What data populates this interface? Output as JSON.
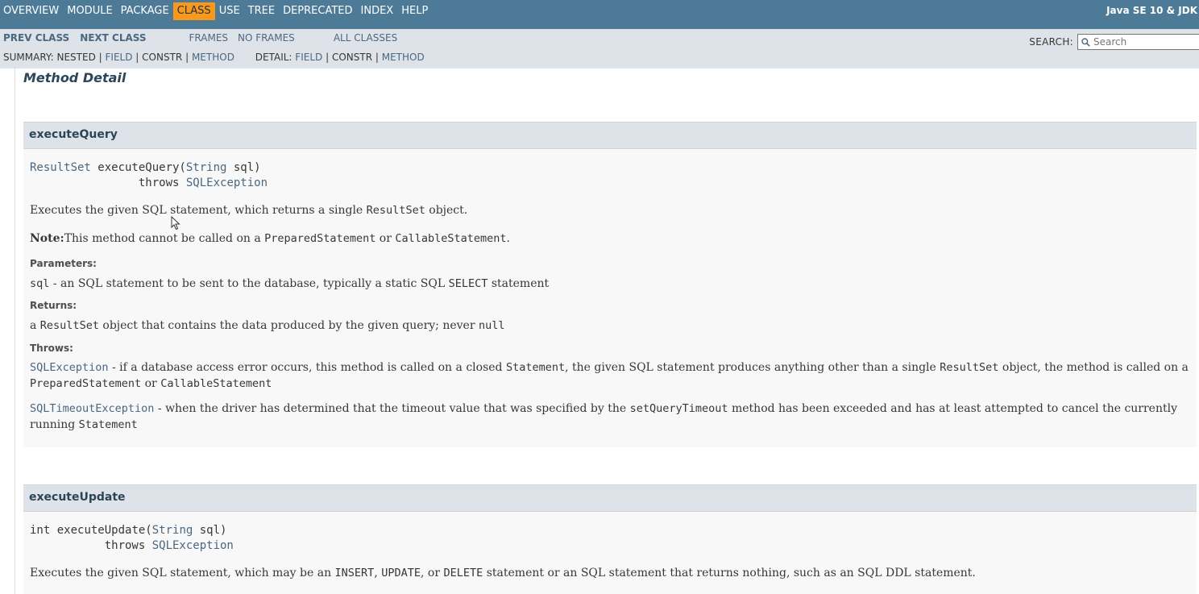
{
  "topnav": {
    "items": [
      {
        "label": "Overview",
        "active": false
      },
      {
        "label": "Module",
        "active": false
      },
      {
        "label": "Package",
        "active": false
      },
      {
        "label": "Class",
        "active": true
      },
      {
        "label": "Use",
        "active": false
      },
      {
        "label": "Tree",
        "active": false
      },
      {
        "label": "Deprecated",
        "active": false
      },
      {
        "label": "Index",
        "active": false
      },
      {
        "label": "Help",
        "active": false
      }
    ],
    "about": "Java SE 10 & JDK"
  },
  "subnav": {
    "prev_class": "PREV CLASS",
    "next_class": "NEXT CLASS",
    "frames": "FRAMES",
    "no_frames": "NO FRAMES",
    "all_classes": "ALL CLASSES",
    "summary_label": "SUMMARY: NESTED |",
    "summary_field": "FIELD",
    "summary_sep1": "|",
    "summary_constr": "CONSTR",
    "summary_sep2": "|",
    "summary_method": "METHOD",
    "detail_label": "DETAIL:",
    "detail_field": "FIELD",
    "detail_sep1": "|",
    "detail_constr": "CONSTR",
    "detail_sep2": "|",
    "detail_method": "METHOD",
    "search_label": "SEARCH:",
    "search_placeholder": "Search"
  },
  "content": {
    "section_title": "Method Detail",
    "method1": {
      "name": "executeQuery",
      "sig_return": "ResultSet",
      "sig_name": " executeQuery(",
      "sig_ptype": "String",
      "sig_pname": " sql)",
      "sig_throws_kw": "                throws ",
      "sig_throws": "SQLException",
      "desc_1": "Executes the given SQL statement, which returns a single ",
      "desc_code": "ResultSet",
      "desc_2": " object.",
      "note_label": "Note:",
      "note_1": "This method cannot be called on a ",
      "note_code1": "PreparedStatement",
      "note_2": " or ",
      "note_code2": "CallableStatement",
      "note_3": ".",
      "params_label": "Parameters:",
      "param_name": "sql",
      "param_desc_1": " - an SQL statement to be sent to the database, typically a static SQL ",
      "param_code": "SELECT",
      "param_desc_2": " statement",
      "returns_label": "Returns:",
      "returns_1": "a ",
      "returns_code1": "ResultSet",
      "returns_2": " object that contains the data produced by the given query; never ",
      "returns_code2": "null",
      "throws_label": "Throws:",
      "throws1_name": "SQLException",
      "throws1_1": " - if a database access error occurs, this method is called on a closed ",
      "throws1_code1": "Statement",
      "throws1_2": ", the given SQL statement produces anything other than a single ",
      "throws1_code2": "ResultSet",
      "throws1_3": " object, the method is called on a ",
      "throws1_code3": "PreparedStatement",
      "throws1_4": " or ",
      "throws1_code4": "CallableStatement",
      "throws2_name": "SQLTimeoutException",
      "throws2_1": " - when the driver has determined that the timeout value that was specified by the ",
      "throws2_code1": "setQueryTimeout",
      "throws2_2": " method has been exceeded and has at least attempted to cancel the currently running ",
      "throws2_code2": "Statement"
    },
    "method2": {
      "name": "executeUpdate",
      "sig_return": "int",
      "sig_name": " executeUpdate(",
      "sig_ptype": "String",
      "sig_pname": " sql)",
      "sig_throws_kw": "           throws ",
      "sig_throws": "SQLException",
      "desc_1": "Executes the given SQL statement, which may be an ",
      "desc_code1": "INSERT",
      "desc_2": ", ",
      "desc_code2": "UPDATE",
      "desc_3": ", or ",
      "desc_code3": "DELETE",
      "desc_4": " statement or an SQL statement that returns nothing, such as an SQL DDL statement."
    }
  }
}
